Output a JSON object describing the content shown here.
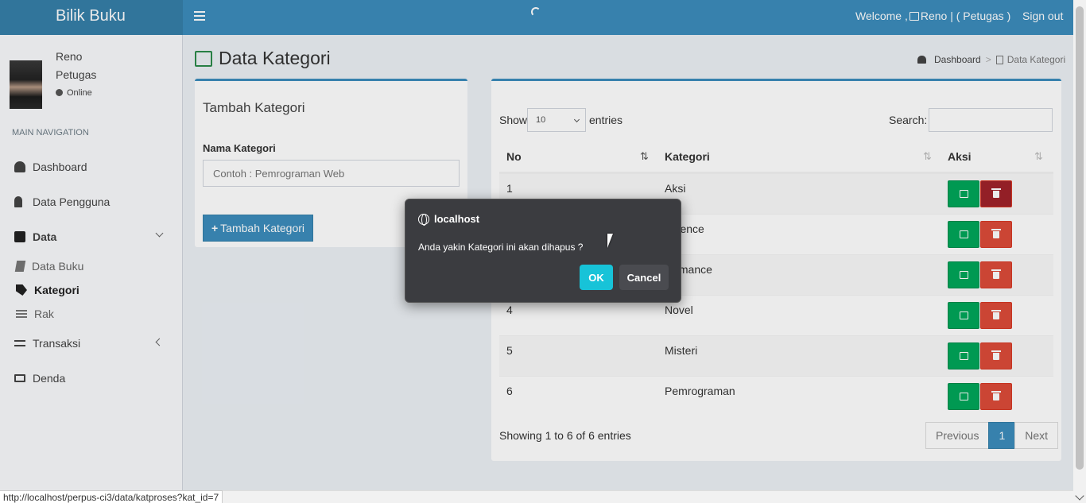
{
  "app": {
    "logo": "Bilik Buku",
    "welcome": "Welcome ,",
    "welcome_user": "Reno | ( Petugas )",
    "signout": "Sign out"
  },
  "user": {
    "name": "Reno",
    "role": "Petugas",
    "status": "Online"
  },
  "sidebar": {
    "header": "MAIN NAVIGATION",
    "items": [
      {
        "label": "Dashboard"
      },
      {
        "label": "Data Pengguna"
      },
      {
        "label": "Data"
      },
      {
        "label": "Data Buku"
      },
      {
        "label": "Kategori"
      },
      {
        "label": "Rak"
      },
      {
        "label": "Transaksi"
      },
      {
        "label": "Denda"
      }
    ]
  },
  "page": {
    "title": "Data Kategori"
  },
  "breadcrumb": {
    "home": "Dashboard",
    "current": "Data Kategori"
  },
  "form": {
    "title": "Tambah Kategori",
    "label": "Nama Kategori",
    "placeholder": "Contoh : Pemrograman Web",
    "button": "Tambah Kategori"
  },
  "table": {
    "show_label": "Show",
    "entries_value": "10",
    "entries_label": "entries",
    "search_label": "Search:",
    "headers": [
      "No",
      "Kategori",
      "Aksi"
    ],
    "rows": [
      {
        "no": "1",
        "kategori": "Aksi"
      },
      {
        "no": "2",
        "kategori": "Science"
      },
      {
        "no": "3",
        "kategori": "Romance"
      },
      {
        "no": "4",
        "kategori": "Novel"
      },
      {
        "no": "5",
        "kategori": "Misteri"
      },
      {
        "no": "6",
        "kategori": "Pemrograman"
      }
    ],
    "info": "Showing 1 to 6 of 6 entries",
    "pagination": {
      "previous": "Previous",
      "page": "1",
      "next": "Next"
    }
  },
  "dialog": {
    "origin": "localhost",
    "message": "Anda yakin Kategori ini akan dihapus ?",
    "ok": "OK",
    "cancel": "Cancel"
  },
  "statusbar": {
    "url": "http://localhost/perpus-ci3/data/katproses?kat_id=7"
  },
  "colors": {
    "header": "#3c8dbc",
    "logo_bg": "#367fa9",
    "success": "#00a65a",
    "danger": "#dd4b39",
    "dialog_ok": "#17c3d8"
  }
}
